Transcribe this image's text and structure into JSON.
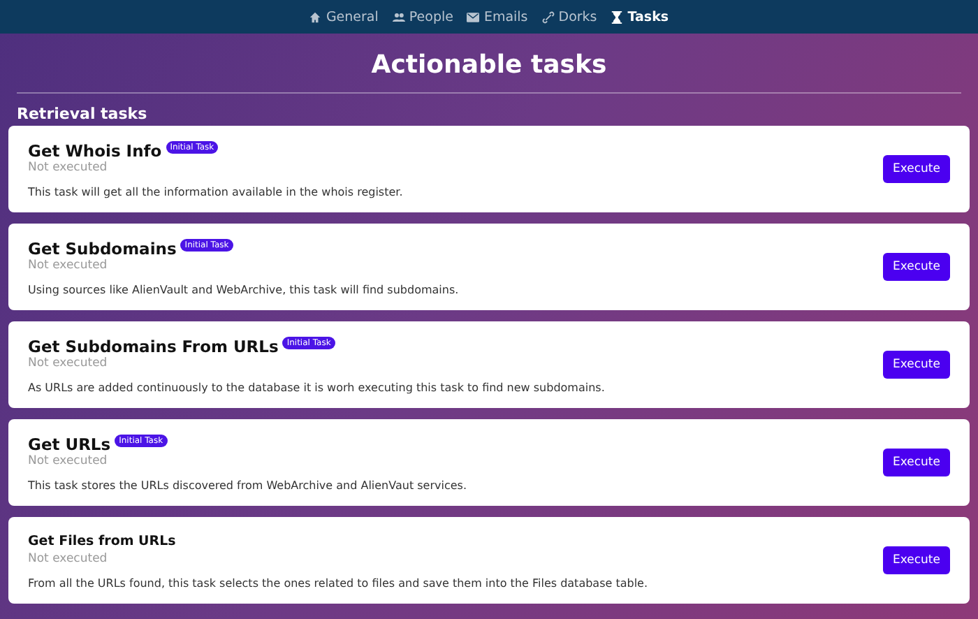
{
  "nav": [
    {
      "kind": "home",
      "label": "General",
      "selected": false
    },
    {
      "kind": "people",
      "label": "People",
      "selected": false
    },
    {
      "kind": "mail",
      "label": "Emails",
      "selected": false
    },
    {
      "kind": "link",
      "label": "Dorks",
      "selected": false
    },
    {
      "kind": "hourglass",
      "label": "Tasks",
      "selected": true
    }
  ],
  "title": "Actionable tasks",
  "section": "Retrieval tasks",
  "tasks": [
    {
      "name": "Get Whois Info",
      "badge": "Initial Task",
      "status": "Not executed",
      "description": "This task will get all the information available in the whois register.",
      "button": "Execute"
    },
    {
      "name": "Get Subdomains",
      "badge": "Initial Task",
      "status": "Not executed",
      "description": "Using sources like AlienVault and WebArchive, this task will find subdomains.",
      "button": "Execute"
    },
    {
      "name": "Get Subdomains From URLs",
      "badge": "Initial Task",
      "status": "Not executed",
      "description": "As URLs are added continuously to the database it is worh executing this task to find new subdomains.",
      "button": "Execute"
    },
    {
      "name": "Get URLs",
      "badge": "Initial Task",
      "status": "Not executed",
      "description": "This task stores the URLs discovered from WebArchive and AlienVaut services.",
      "button": "Execute"
    },
    {
      "name": "Get Files from URLs",
      "status": "Not executed",
      "description": "From all the URLs found, this task selects the ones related to files and save them into the Files database table.",
      "button": "Execute"
    }
  ]
}
